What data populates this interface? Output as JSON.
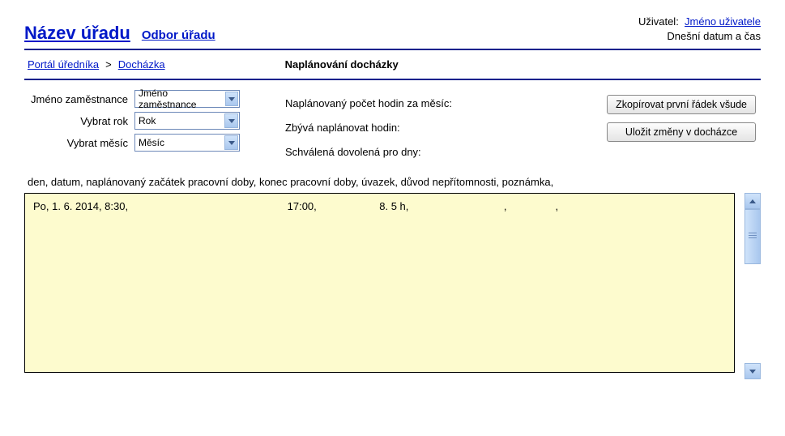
{
  "header": {
    "office_name": "Název úřadu",
    "department": "Odbor úřadu",
    "user_label": "Uživatel:",
    "user_name": "Jméno uživatele",
    "datetime": "Dnešní datum a čas"
  },
  "breadcrumb": {
    "portal": "Portál úředníka",
    "sep1": ">",
    "attendance": "Docházka",
    "page_title": "Naplánování docházky"
  },
  "form": {
    "employee_label": "Jméno zaměstnance",
    "employee_value": "Jméno zaměstnance",
    "year_label": "Vybrat rok",
    "year_value": "Rok",
    "month_label": "Vybrat měsíc",
    "month_value": "Měsíc"
  },
  "info": {
    "planned_hours": "Naplánovaný počet hodin za měsíc:",
    "remaining_hours": "Zbývá naplánovat hodin:",
    "approved_vacation": "Schválená dovolená pro dny:"
  },
  "buttons": {
    "copy_first": "Zkopírovat první řádek všude",
    "save": "Uložit změny v docházce"
  },
  "columns_desc": "den, datum, naplánovaný začátek pracovní doby, konec pracovní doby, úvazek, důvod nepřítomnosti, poznámka,",
  "textarea": {
    "c1": "Po, 1. 6. 2014, 8:30,",
    "c2": "17:00,",
    "c3": "8. 5 h,",
    "c4": ",",
    "c5": ","
  }
}
